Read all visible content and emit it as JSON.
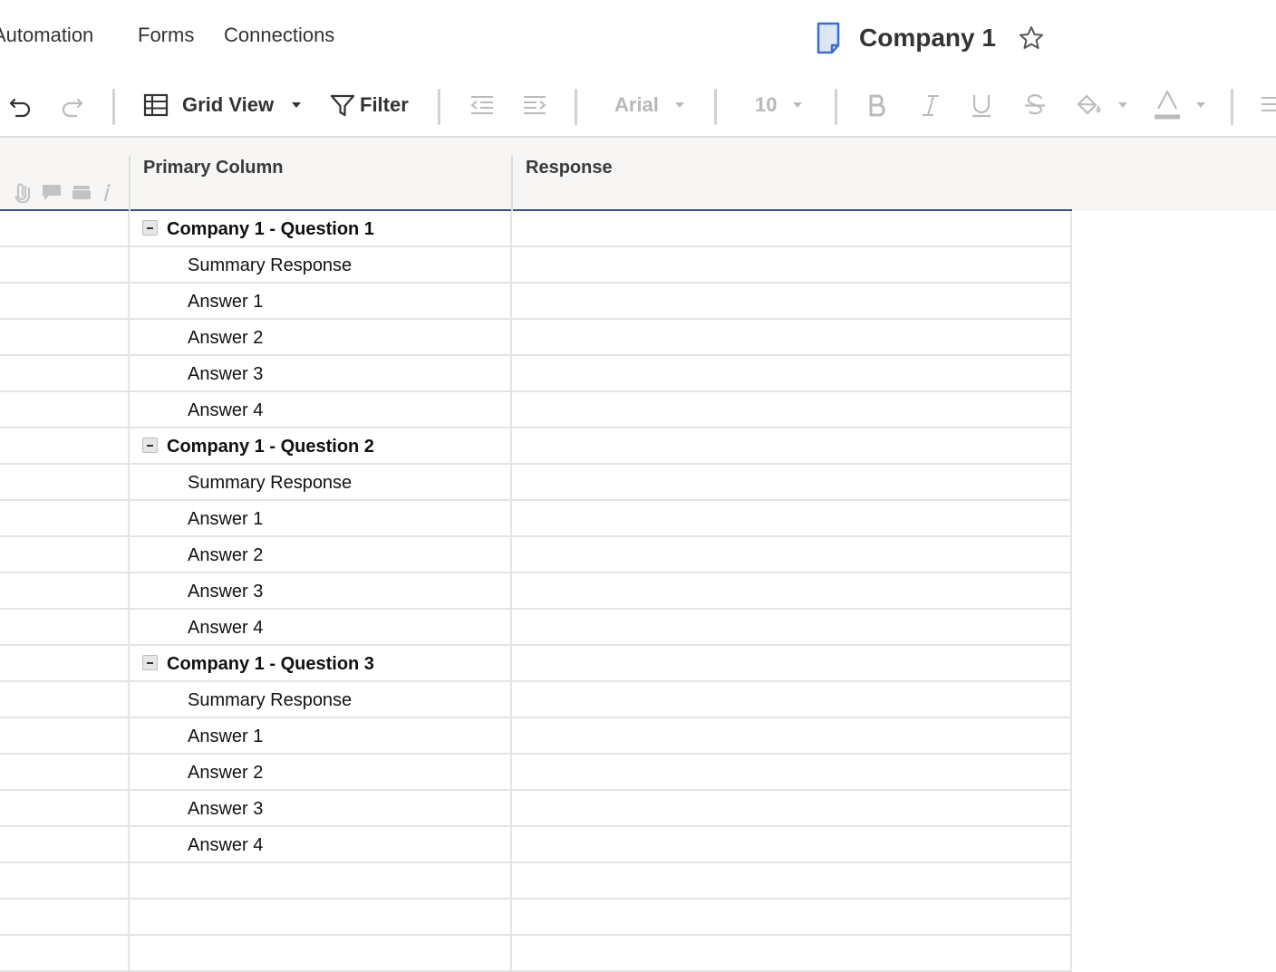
{
  "menu": {
    "items": [
      {
        "label": "Automation"
      },
      {
        "label": "Forms"
      },
      {
        "label": "Connections"
      }
    ]
  },
  "sheet": {
    "title": "Company 1"
  },
  "toolbar": {
    "view_label": "Grid View",
    "filter_label": "Filter",
    "font_family": "Arial",
    "font_size": "10"
  },
  "grid": {
    "columns": [
      {
        "label": "Primary Column"
      },
      {
        "label": "Response"
      }
    ],
    "rows": [
      {
        "primary": "Company 1 - Question 1",
        "response": "",
        "parent": true
      },
      {
        "primary": "Summary Response",
        "response": ""
      },
      {
        "primary": "Answer 1",
        "response": ""
      },
      {
        "primary": "Answer 2",
        "response": ""
      },
      {
        "primary": "Answer 3",
        "response": ""
      },
      {
        "primary": "Answer 4",
        "response": ""
      },
      {
        "primary": "Company 1 - Question 2",
        "response": "",
        "parent": true
      },
      {
        "primary": "Summary Response",
        "response": ""
      },
      {
        "primary": "Answer 1",
        "response": ""
      },
      {
        "primary": "Answer 2",
        "response": ""
      },
      {
        "primary": "Answer 3",
        "response": ""
      },
      {
        "primary": "Answer 4",
        "response": ""
      },
      {
        "primary": "Company 1 - Question 3",
        "response": "",
        "parent": true
      },
      {
        "primary": "Summary Response",
        "response": ""
      },
      {
        "primary": "Answer 1",
        "response": ""
      },
      {
        "primary": "Answer 2",
        "response": ""
      },
      {
        "primary": "Answer 3",
        "response": ""
      },
      {
        "primary": "Answer 4",
        "response": ""
      },
      {
        "primary": "",
        "response": ""
      },
      {
        "primary": "",
        "response": ""
      },
      {
        "primary": "",
        "response": ""
      }
    ]
  },
  "colors": {
    "accent_line": "#34508a",
    "header_bg": "#f7f6f4",
    "sheet_icon": "#3b6fc4"
  }
}
